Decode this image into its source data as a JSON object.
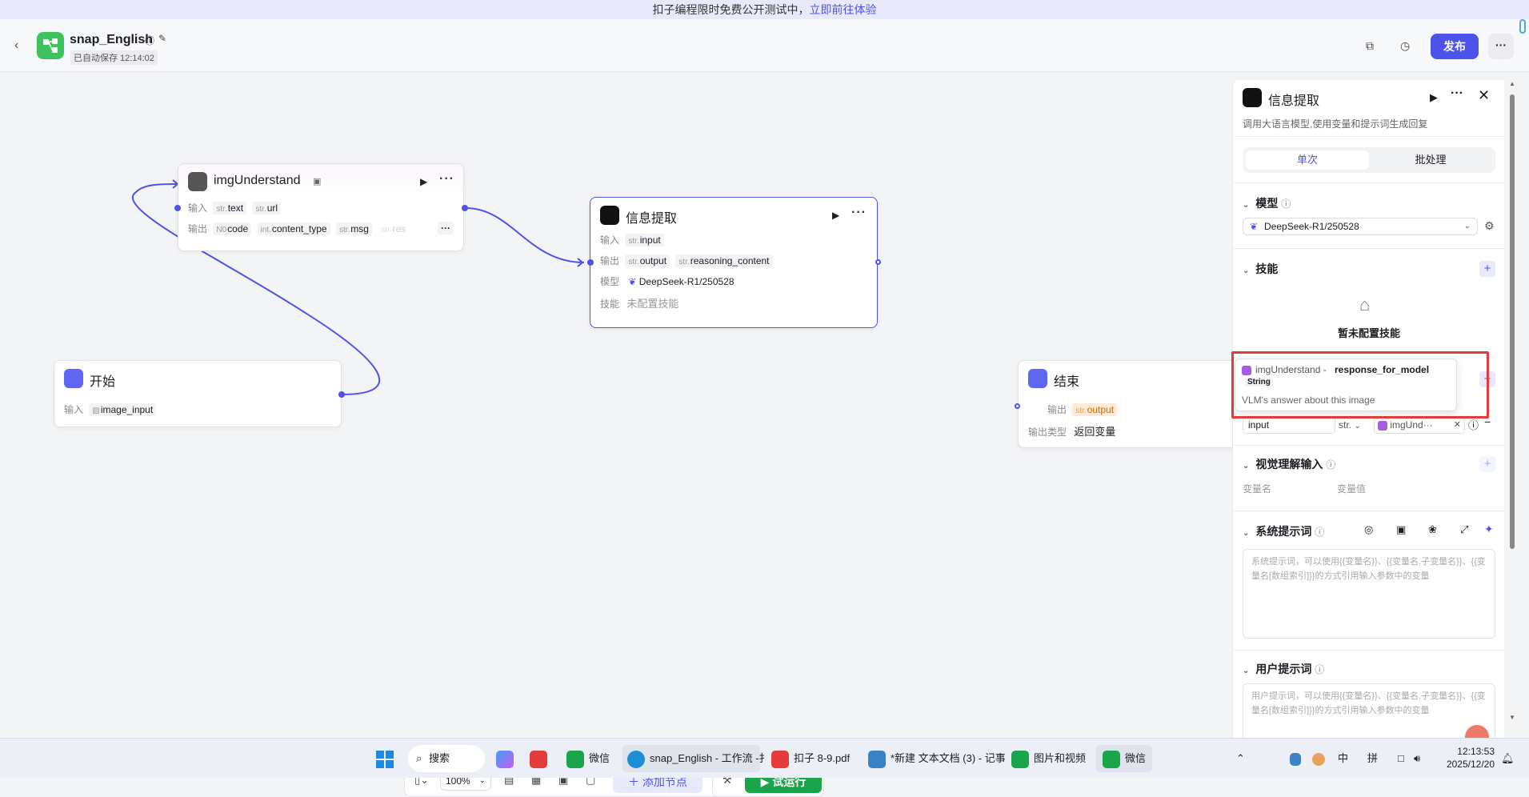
{
  "banner": {
    "text": "扣子编程限时免费公开测试中，",
    "link": "立即前往体验"
  },
  "header": {
    "app_name": "snap_English",
    "saved": "已自动保存 12:14:02",
    "publish": "发布"
  },
  "nodes": {
    "img": {
      "title": "imgUnderstand",
      "in_label": "输入",
      "out_label": "输出",
      "inputs": [
        {
          "type": "str.",
          "name": "text"
        },
        {
          "type": "str.",
          "name": "url"
        }
      ],
      "outputs": [
        {
          "type": "N0",
          "name": "code"
        },
        {
          "type": "int.",
          "name": "content_type"
        },
        {
          "type": "str.",
          "name": "msg"
        },
        {
          "type": "str.",
          "name": "res"
        }
      ]
    },
    "info": {
      "title": "信息提取",
      "in_label": "输入",
      "out_label": "输出",
      "model_label": "模型",
      "skill_label": "技能",
      "inputs": [
        {
          "type": "str.",
          "name": "input"
        }
      ],
      "outputs": [
        {
          "type": "str.",
          "name": "output"
        },
        {
          "type": "str.",
          "name": "reasoning_content"
        }
      ],
      "model": "DeepSeek-R1/250528",
      "skill": "未配置技能"
    },
    "start": {
      "title": "开始",
      "in_label": "输入",
      "input": "image_input"
    },
    "end": {
      "title": "结束",
      "out_label": "输出",
      "output_type": "str.",
      "output": "output",
      "type_label": "输出类型",
      "type_value": "返回变量"
    }
  },
  "toolbar": {
    "zoom": "100%",
    "add_node": "添加节点",
    "trial_run": "试运行"
  },
  "panel": {
    "title": "信息提取",
    "desc": "调用大语言模型,使用变量和提示词生成回复",
    "tabs": [
      "单次",
      "批处理"
    ],
    "model_section": "模型",
    "model_value": "DeepSeek-R1/250528",
    "skill_section": "技能",
    "skill_empty": "暂未配置技能",
    "input_name": "input",
    "input_type": "str.",
    "input_ref": "imgUnd···",
    "vision_section": "视觉理解输入",
    "var_name": "变量名",
    "var_value": "变量值",
    "system_section": "系统提示词",
    "system_placeholder": "系统提示词，可以使用{{变量名}}、{{变量名.子变量名}}、{{变量名[数组索引]}}的方式引用输入参数中的变量",
    "user_section": "用户提示词",
    "user_placeholder": "用户提示词，可以使用{{变量名}}、{{变量名.子变量名}}、{{变量名[数组索引]}}的方式引用输入参数中的变量"
  },
  "popup": {
    "source": "imgUnderstand -",
    "field": "response_for_model",
    "type": "String",
    "desc": "VLM's answer about this image"
  },
  "taskbar": {
    "search": "搜索",
    "apps": [
      "微信",
      "snap_English - 工作流 -扌",
      "扣子 8-9.pdf",
      "*新建 文本文档 (3) - 记事",
      "图片和视频",
      "微信"
    ],
    "ime1": "中",
    "ime2": "拼",
    "time": "12:13:53",
    "date": "2025/12/20"
  },
  "colors": {
    "accent": "#4d53e8",
    "green": "#1aa44b",
    "red_box": "#e53b3b"
  }
}
